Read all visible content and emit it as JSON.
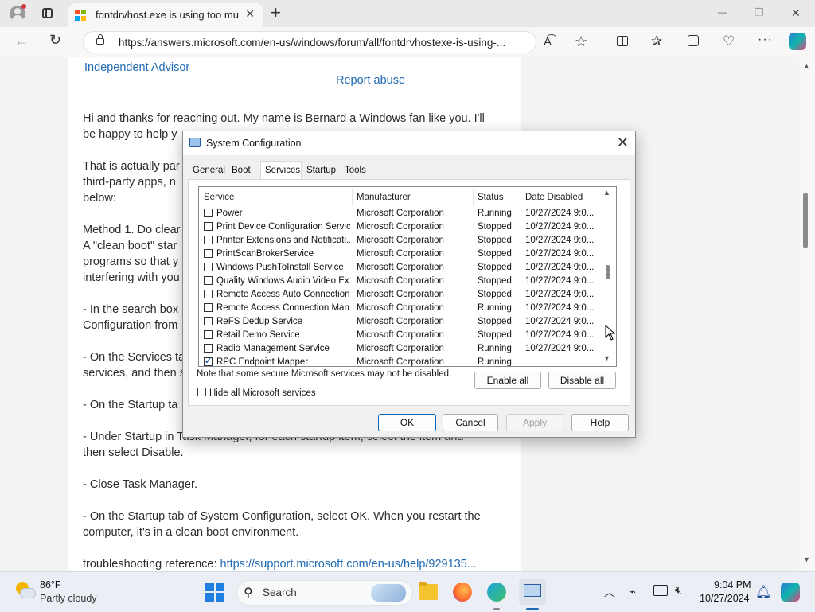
{
  "browser": {
    "tab_title": "fontdrvhost.exe is using too much",
    "tab_close": "✕",
    "new_tab": "+",
    "url": "https://answers.microsoft.com/en-us/windows/forum/all/fontdrvhostexe-is-using-...",
    "window_controls": {
      "minimize": "—",
      "restore": "❐",
      "close": "✕"
    }
  },
  "article": {
    "author_role": "Independent Advisor",
    "report_abuse": "Report abuse",
    "paragraphs": [
      "Hi and thanks for reaching out. My name is Bernard a Windows fan like you. I'll",
      "be happy to help y",
      "That is actually par",
      "third-party apps, n",
      "below:",
      "Method 1. Do clear",
      "A \"clean boot\" star",
      "programs so that y",
      "interfering with you",
      "- In the search box",
      "Configuration from",
      "- On the Services ta",
      "services, and then s",
      "- On the Startup ta",
      "- Under Startup in Task Manager, for each startup item, select the item and",
      "then select Disable.",
      "- Close Task Manager.",
      "- On the Startup tab of System Configuration, select OK. When you restart the",
      "computer, it's in a clean boot environment.",
      "troubleshooting reference: "
    ],
    "reference_link": "https://support.microsoft.com/en-us/help/929135..."
  },
  "dialog": {
    "title": "System Configuration",
    "close": "✕",
    "tabs": [
      "General",
      "Boot",
      "Services",
      "Startup",
      "Tools"
    ],
    "active_tab": "Services",
    "columns": [
      "Service",
      "Manufacturer",
      "Status",
      "Date Disabled"
    ],
    "rows": [
      {
        "service": "Power",
        "manufacturer": "Microsoft Corporation",
        "status": "Running",
        "date": "10/27/2024 9:0...",
        "checked": false
      },
      {
        "service": "Print Device Configuration Service",
        "manufacturer": "Microsoft Corporation",
        "status": "Stopped",
        "date": "10/27/2024 9:0...",
        "checked": false
      },
      {
        "service": "Printer Extensions and Notificati...",
        "manufacturer": "Microsoft Corporation",
        "status": "Stopped",
        "date": "10/27/2024 9:0...",
        "checked": false
      },
      {
        "service": "PrintScanBrokerService",
        "manufacturer": "Microsoft Corporation",
        "status": "Stopped",
        "date": "10/27/2024 9:0...",
        "checked": false
      },
      {
        "service": "Windows PushToInstall Service",
        "manufacturer": "Microsoft Corporation",
        "status": "Stopped",
        "date": "10/27/2024 9:0...",
        "checked": false
      },
      {
        "service": "Quality Windows Audio Video Ex...",
        "manufacturer": "Microsoft Corporation",
        "status": "Stopped",
        "date": "10/27/2024 9:0...",
        "checked": false
      },
      {
        "service": "Remote Access Auto Connection...",
        "manufacturer": "Microsoft Corporation",
        "status": "Stopped",
        "date": "10/27/2024 9:0...",
        "checked": false
      },
      {
        "service": "Remote Access Connection Man...",
        "manufacturer": "Microsoft Corporation",
        "status": "Running",
        "date": "10/27/2024 9:0...",
        "checked": false
      },
      {
        "service": "ReFS Dedup Service",
        "manufacturer": "Microsoft Corporation",
        "status": "Stopped",
        "date": "10/27/2024 9:0...",
        "checked": false
      },
      {
        "service": "Retail Demo Service",
        "manufacturer": "Microsoft Corporation",
        "status": "Stopped",
        "date": "10/27/2024 9:0...",
        "checked": false
      },
      {
        "service": "Radio Management Service",
        "manufacturer": "Microsoft Corporation",
        "status": "Running",
        "date": "10/27/2024 9:0...",
        "checked": false
      },
      {
        "service": "RPC Endpoint Mapper",
        "manufacturer": "Microsoft Corporation",
        "status": "Running",
        "date": "",
        "checked": true
      }
    ],
    "note": "Note that some secure Microsoft services may not be disabled.",
    "enable_all": "Enable all",
    "disable_all": "Disable all",
    "hide_ms": "Hide all Microsoft services",
    "ok": "OK",
    "cancel": "Cancel",
    "apply": "Apply",
    "help": "Help"
  },
  "taskbar": {
    "weather_temp": "86°F",
    "weather_desc": "Partly cloudy",
    "search_label": "Search",
    "time": "9:04 PM",
    "date": "10/27/2024"
  },
  "colors": {
    "link": "#1f6ab3",
    "accent": "#0067c0"
  }
}
